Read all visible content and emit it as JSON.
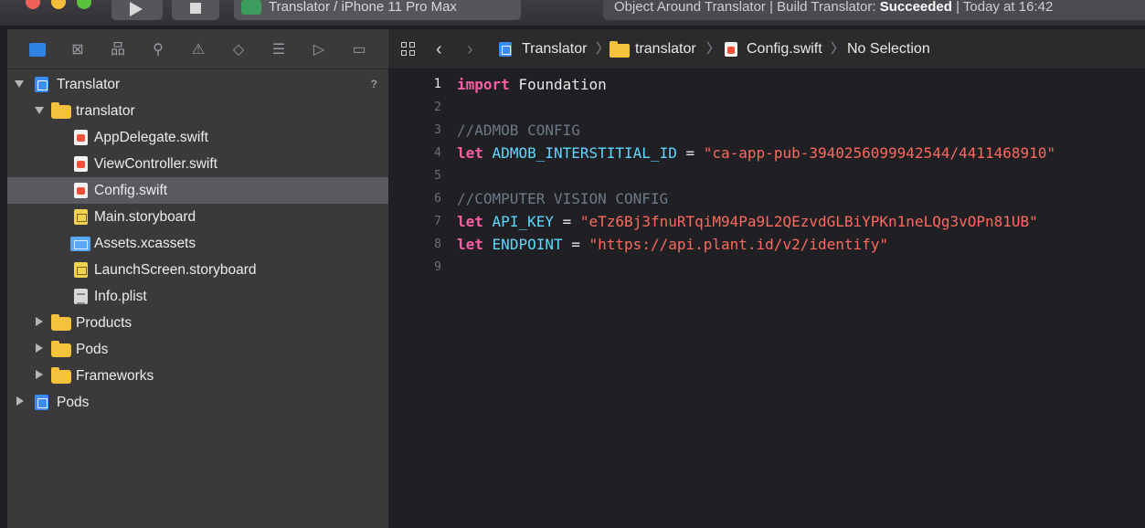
{
  "titlebar": {
    "scheme": "Translator / iPhone 11 Pro Max",
    "activity_prefix": "Object Around Translator | Build Translator: ",
    "activity_status": "Succeeded",
    "activity_suffix": " | Today at 16:42"
  },
  "navigator": {
    "tabs": [
      "project-navigator",
      "source-control-navigator",
      "symbol-navigator",
      "find-navigator",
      "issue-navigator",
      "test-navigator",
      "debug-navigator",
      "breakpoint-navigator",
      "report-navigator"
    ],
    "tree": [
      {
        "label": "Translator",
        "icon": "project-icon",
        "disclosure": "open",
        "level": 0,
        "badge": "?"
      },
      {
        "label": "translator",
        "icon": "folder-icon",
        "disclosure": "open",
        "level": 1
      },
      {
        "label": "AppDelegate.swift",
        "icon": "swift-file-icon",
        "level": 2
      },
      {
        "label": "ViewController.swift",
        "icon": "swift-file-icon",
        "level": 2
      },
      {
        "label": "Config.swift",
        "icon": "swift-file-icon",
        "level": 2,
        "selected": true
      },
      {
        "label": "Main.storyboard",
        "icon": "storyboard-file-icon",
        "level": 2
      },
      {
        "label": "Assets.xcassets",
        "icon": "assets-icon",
        "level": 2
      },
      {
        "label": "LaunchScreen.storyboard",
        "icon": "storyboard-file-icon",
        "level": 2
      },
      {
        "label": "Info.plist",
        "icon": "plist-file-icon",
        "level": 2
      },
      {
        "label": "Products",
        "icon": "folder-icon",
        "disclosure": "closed",
        "level": 1
      },
      {
        "label": "Pods",
        "icon": "folder-icon",
        "disclosure": "closed",
        "level": 1
      },
      {
        "label": "Frameworks",
        "icon": "folder-icon",
        "disclosure": "closed",
        "level": 1
      },
      {
        "label": "Pods",
        "icon": "project-icon",
        "disclosure": "closed",
        "level": 0
      }
    ]
  },
  "jumpbar": {
    "project": "Translator",
    "group": "translator",
    "file": "Config.swift",
    "selection": "No Selection"
  },
  "code": {
    "current_line": 1,
    "lines": [
      [
        {
          "t": "import",
          "c": "kw"
        },
        {
          "t": " Foundation",
          "c": "tx"
        }
      ],
      [],
      [
        {
          "t": "//ADMOB CONFIG",
          "c": "cm"
        }
      ],
      [
        {
          "t": "let",
          "c": "kw"
        },
        {
          "t": " ",
          "c": "tx"
        },
        {
          "t": "ADMOB_INTERSTITIAL_ID",
          "c": "id"
        },
        {
          "t": " = ",
          "c": "tx"
        },
        {
          "t": "\"ca-app-pub-3940256099942544/4411468910\"",
          "c": "str"
        }
      ],
      [],
      [
        {
          "t": "//COMPUTER VISION CONFIG",
          "c": "cm"
        }
      ],
      [
        {
          "t": "let",
          "c": "kw"
        },
        {
          "t": " ",
          "c": "tx"
        },
        {
          "t": "API_KEY",
          "c": "id"
        },
        {
          "t": " = ",
          "c": "tx"
        },
        {
          "t": "\"eTz6Bj3fnuRTqiM94Pa9L2QEzvdGLBiYPKn1neLQg3vOPn81UB\"",
          "c": "str"
        }
      ],
      [
        {
          "t": "let",
          "c": "kw"
        },
        {
          "t": " ",
          "c": "tx"
        },
        {
          "t": "ENDPOINT",
          "c": "id"
        },
        {
          "t": " = ",
          "c": "tx"
        },
        {
          "t": "\"https://api.plant.id/v2/identify\"",
          "c": "str"
        }
      ],
      []
    ]
  },
  "colors": {
    "keyword": "#fc5fa3",
    "identifier": "#5dd8ff",
    "string": "#fc6a5d",
    "comment": "#6c7986",
    "selection": "#5a5a5e",
    "accent": "#2f8cf5"
  }
}
